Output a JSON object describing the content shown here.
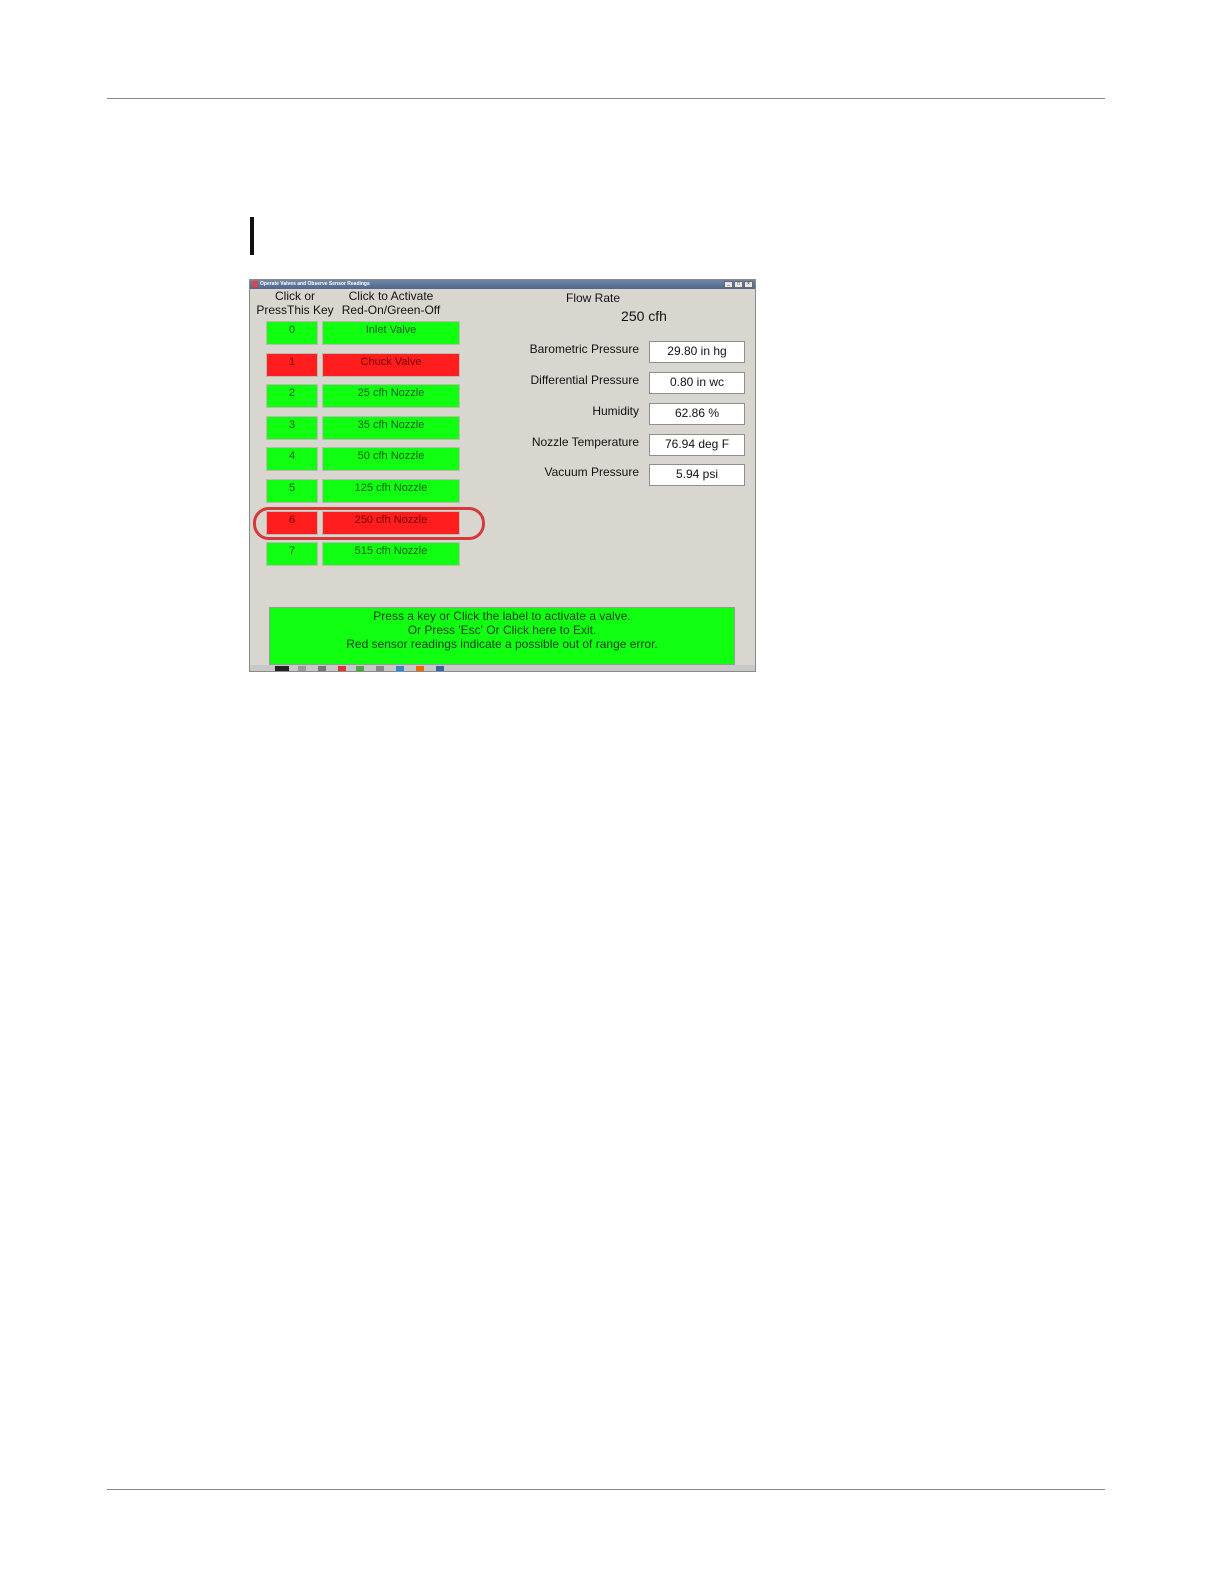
{
  "window": {
    "title": "Operate Valves and Observe Sensor Readings"
  },
  "headers": {
    "key_col": [
      "Click or",
      "PressThis Key"
    ],
    "activate_col": [
      "Click to Activate",
      "Red-On/Green-Off"
    ]
  },
  "valves": [
    {
      "key": "0",
      "label": "Inlet Valve",
      "state": "off"
    },
    {
      "key": "1",
      "label": "Chuck Valve",
      "state": "on"
    },
    {
      "key": "2",
      "label": "25 cfh Nozzle",
      "state": "off"
    },
    {
      "key": "3",
      "label": "35 cfh Nozzle",
      "state": "off"
    },
    {
      "key": "4",
      "label": "50 cfh Nozzle",
      "state": "off"
    },
    {
      "key": "5",
      "label": "125 cfh Nozzle",
      "state": "off"
    },
    {
      "key": "6",
      "label": "250 cfh Nozzle",
      "state": "on"
    },
    {
      "key": "7",
      "label": "515 cfh Nozzle",
      "state": "off"
    }
  ],
  "flow": {
    "label": "Flow Rate",
    "value": "250 cfh"
  },
  "readings": [
    {
      "label": "Barometric Pressure",
      "value": "29.80 in hg"
    },
    {
      "label": "Differential Pressure",
      "value": "0.80 in wc"
    },
    {
      "label": "Humidity",
      "value": "62.86 %"
    },
    {
      "label": "Nozzle Temperature",
      "value": "76.94 deg F"
    },
    {
      "label": "Vacuum Pressure",
      "value": "5.94 psi"
    }
  ],
  "status": {
    "lines": [
      "Press a key or Click the label to activate a valve.",
      "Or Press 'Esc' Or Click here to Exit.",
      "Red sensor readings indicate a possible out of range error."
    ]
  },
  "colors": {
    "valve_on": "#ff1d1d",
    "valve_off": "#11ff11",
    "highlight": "#d43a3a"
  }
}
